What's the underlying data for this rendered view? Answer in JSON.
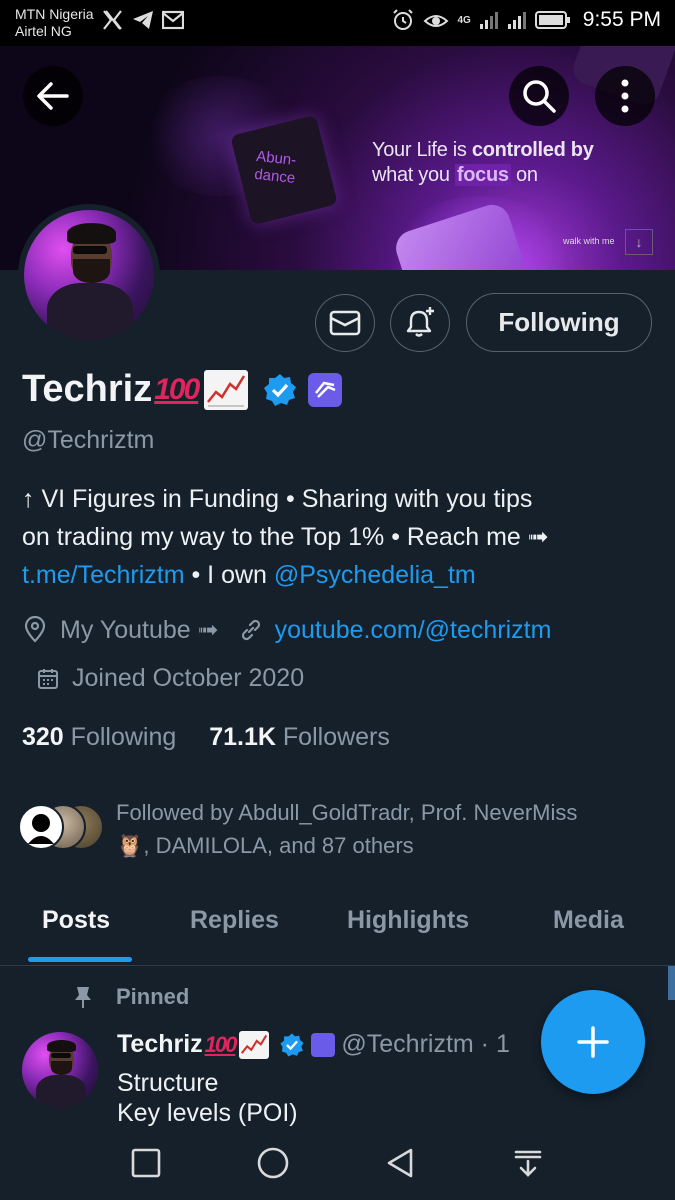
{
  "status_bar": {
    "carrier_1": "MTN Nigeria",
    "carrier_2": "Airtel NG",
    "network": "4G",
    "time": "9:55 PM"
  },
  "banner": {
    "cube_text": "Abun-\ndance",
    "quote_part1": "Your Life is ",
    "quote_bold": "controlled by",
    "quote_part2": "what you ",
    "quote_highlight": "focus",
    "quote_part3": " on",
    "small_text": "walk with me",
    "bg_color": "#2a0c3f"
  },
  "header": {
    "back_icon": "arrow-left-icon",
    "search_icon": "search-icon",
    "more_icon": "more-vertical-icon"
  },
  "profile": {
    "name": "Techriz",
    "emoji_100": "💯",
    "handle": "@Techriztm",
    "bio_line1": "↑ VI Figures in Funding • Sharing with you tips",
    "bio_line2": "on trading my way to the Top 1% • Reach me ➟",
    "bio_link1": "t.me/Techriztm",
    "bio_mid": " • I own ",
    "bio_link2": "@Psychedelia_tm",
    "location": "My Youtube ➟",
    "website": "youtube.com/@techriztm",
    "joined": "Joined October 2020",
    "following_count": "320",
    "following_label": "Following",
    "followers_count": "71.1K",
    "followers_label": "Followers",
    "followed_by": "Followed by Abdull_GoldTradr, Prof. NeverMiss",
    "followed_by_2": "🦉, DAMILOLA, and 87 others",
    "follow_button": "Following",
    "accent": "#1d9bf0"
  },
  "tabs": [
    {
      "label": "Posts"
    },
    {
      "label": "Replies"
    },
    {
      "label": "Highlights"
    },
    {
      "label": "Media"
    }
  ],
  "pinned_post": {
    "pinned_label": "Pinned",
    "author": "Techriz",
    "emoji_100": "💯",
    "handle": "@Techriztm · 1",
    "line1": "Structure",
    "line2": "Key levels (POI)"
  }
}
